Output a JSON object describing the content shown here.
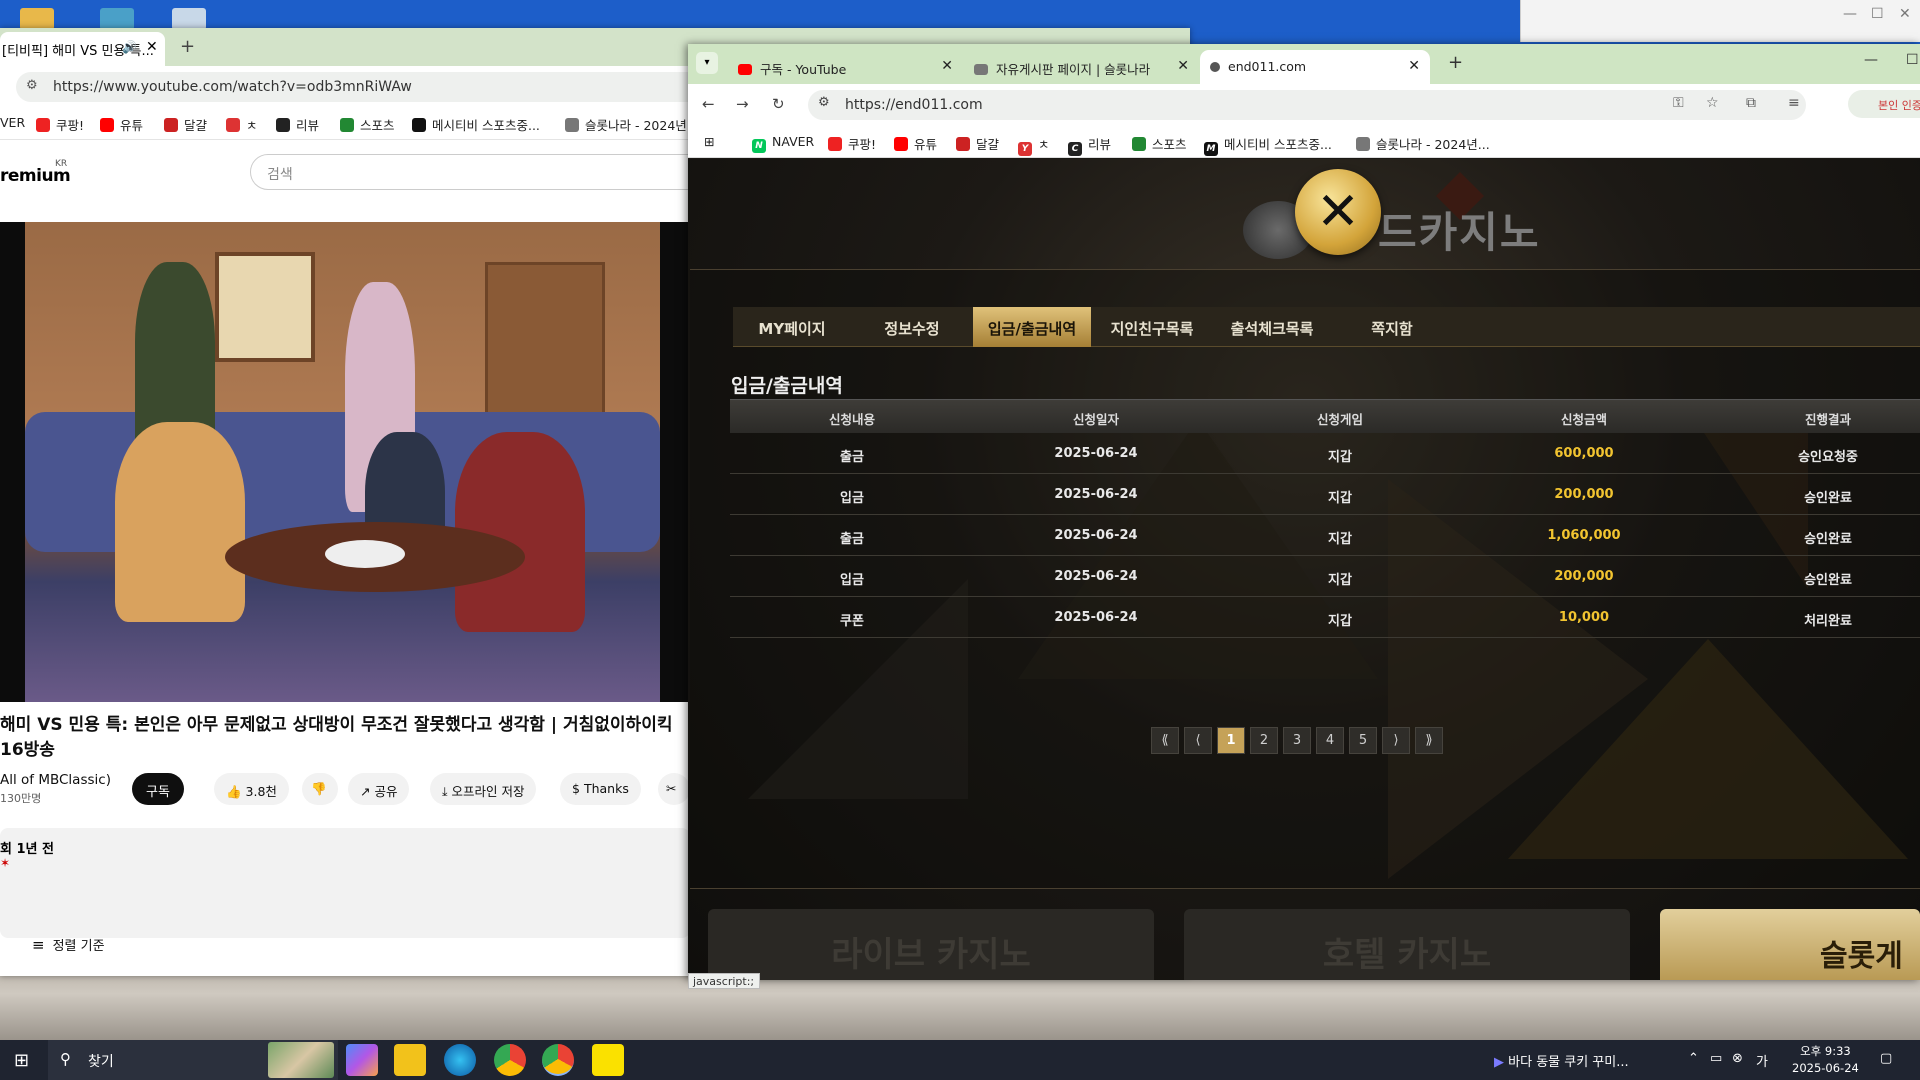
{
  "youtube_window": {
    "tab_title": "[티비픽] 해미 VS 민용 특...",
    "url": "https://www.youtube.com/watch?v=odb3mnRiWAw",
    "bookmarks": [
      "VER",
      "쿠팡!",
      "유튜",
      "달걀",
      "ㅊ",
      "리뷰",
      "스포츠",
      "메시티비 스포츠중...",
      "슬롯나라 - 2024년..."
    ],
    "logo": "remium",
    "logo_sup": "KR",
    "search_placeholder": "검색",
    "video_title_line1": "해미 VS 민용 특: 본인은 아무 문제없고 상대방이 무조건 잘못했다고 생각함 | 거침없이하이킥",
    "video_title_line2": "16방송",
    "channel": "All of MBClassic)",
    "subscribers": "130만명",
    "subscribe_label": "구독",
    "like_count": "3.8천",
    "share_label": "공유",
    "download_label": "오프라인 저장",
    "thanks_label": "Thanks",
    "views_date": "회  1년 전",
    "sort_label": "정렬 기준"
  },
  "casino_window": {
    "tabs": [
      {
        "title": "구독 - YouTube",
        "favicon_color": "#ff0000"
      },
      {
        "title": "자유게시판 페이지 | 슬롯나라",
        "favicon_color": "#666666"
      },
      {
        "title": "end011.com",
        "favicon_color": "#555555"
      }
    ],
    "url": "https://end011.com",
    "bookmarks": [
      "NAVER",
      "쿠팡!",
      "유튜",
      "달걀",
      "ㅊ",
      "리뷰",
      "스포츠",
      "메시티비 스포츠중...",
      "슬롯나라 - 2024년..."
    ],
    "profile_label": "본인 인증",
    "logo_text": "드카지노",
    "menu": [
      "MY페이지",
      "정보수정",
      "입금/출금내역",
      "지인친구목록",
      "출석체크목록",
      "쪽지함"
    ],
    "active_menu_index": 2,
    "page_title": "입금/출금내역",
    "table": {
      "headers": [
        "신청내용",
        "신청일자",
        "신청게임",
        "신청금액",
        "진행결과"
      ],
      "rows": [
        [
          "출금",
          "2025-06-24",
          "지갑",
          "600,000",
          "승인요청중"
        ],
        [
          "입금",
          "2025-06-24",
          "지갑",
          "200,000",
          "승인완료"
        ],
        [
          "출금",
          "2025-06-24",
          "지갑",
          "1,060,000",
          "승인완료"
        ],
        [
          "입금",
          "2025-06-24",
          "지갑",
          "200,000",
          "승인완료"
        ],
        [
          "쿠폰",
          "2025-06-24",
          "지갑",
          "10,000",
          "처리완료"
        ]
      ]
    },
    "pagination": {
      "first": "⟪",
      "prev": "⟨",
      "pages": [
        "1",
        "2",
        "3",
        "4",
        "5"
      ],
      "current": "1",
      "next": "⟩",
      "last": "⟫"
    },
    "promos": [
      "라이브 카지노",
      "호텔 카지노",
      "슬롯게"
    ],
    "status_text": "javascript:;"
  },
  "taskbar": {
    "search_label": "찾기",
    "media_text": "바다 동물 쿠키 꾸미...",
    "time": "오후 9:33",
    "date": "2025-06-24"
  },
  "colors": {
    "accent_gold": "#c5a258",
    "amount_yellow": "#f2c430",
    "site_bg": "#1c1915"
  }
}
